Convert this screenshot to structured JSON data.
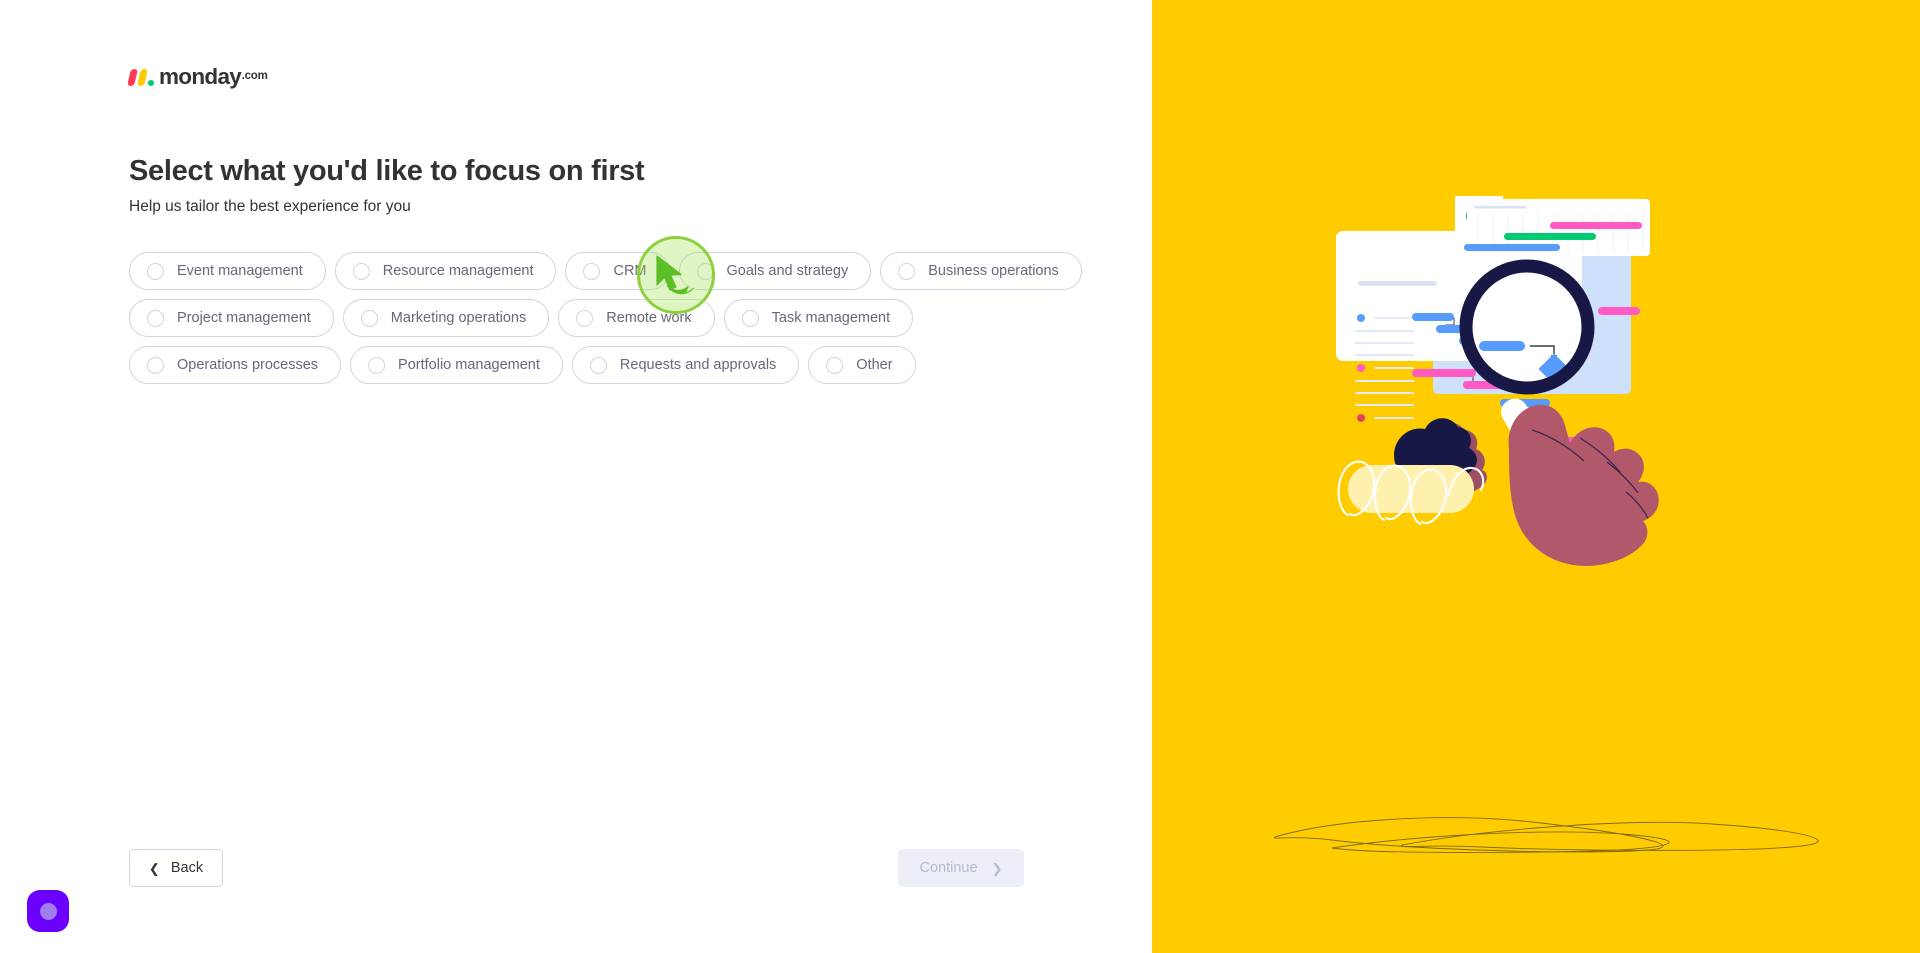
{
  "brand": {
    "logo_word": "monday",
    "logo_tld": ".com",
    "accent_pink": "#ff3d57",
    "accent_yellow": "#ffcb00",
    "accent_green": "#00ca72",
    "panel_yellow": "#ffcc00",
    "purple": "#6c00ff",
    "click_green": "#8ed03c"
  },
  "header": {
    "title": "Select what you'd like to focus on first",
    "subtitle": "Help us tailor the best experience for you"
  },
  "options": {
    "rows": [
      [
        {
          "label": "Event management",
          "selected": false
        },
        {
          "label": "Resource management",
          "selected": false
        },
        {
          "label": "CRM",
          "selected": false
        },
        {
          "label": "Goals and strategy",
          "selected": false,
          "hovered": true
        },
        {
          "label": "Business operations",
          "selected": false
        }
      ],
      [
        {
          "label": "Project management",
          "selected": false
        },
        {
          "label": "Marketing operations",
          "selected": false
        },
        {
          "label": "Remote work",
          "selected": false
        },
        {
          "label": "Task management",
          "selected": false
        }
      ],
      [
        {
          "label": "Operations processes",
          "selected": false
        },
        {
          "label": "Portfolio management",
          "selected": false
        },
        {
          "label": "Requests and approvals",
          "selected": false
        },
        {
          "label": "Other",
          "selected": false
        }
      ]
    ]
  },
  "footer": {
    "back_label": "Back",
    "back_icon": "chevron-left-icon",
    "continue_label": "Continue",
    "continue_icon": "chevron-right-icon",
    "continue_disabled": true
  },
  "support": {
    "icon": "support-bubble-icon"
  },
  "illustration": {
    "alt": "hand-holding-magnifying-glass-over-gantt-board",
    "background_color": "#ffcc00",
    "elements": [
      "pie-chart-card",
      "gantt-timeline-card",
      "main-board-card",
      "magnifying-glass",
      "hand",
      "dark-blob",
      "pale-pill-scribble",
      "ground-scribble"
    ]
  }
}
